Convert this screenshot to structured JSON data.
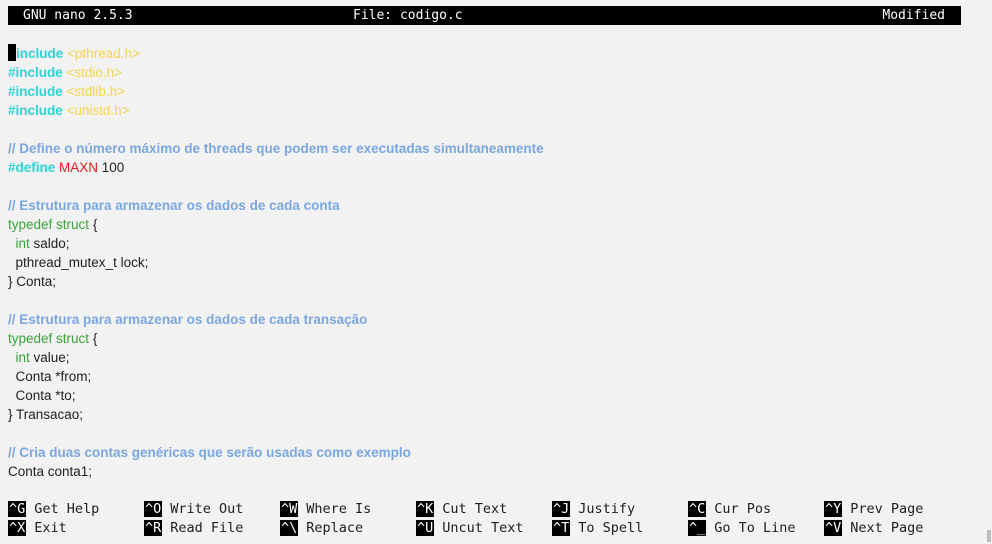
{
  "titlebar": {
    "app_version": "GNU nano 2.5.3",
    "file_label": "File: codigo.c",
    "status": "Modified"
  },
  "code": {
    "l1a": "include",
    "l1b": " <pthread.h>",
    "l2a": "#include",
    "l2b": " <stdio.h>",
    "l3a": "#include",
    "l3b": " <stdlib.h>",
    "l4a": "#include",
    "l4b": " <unistd.h>",
    "c1": "// Define o número máximo de threads que podem ser executadas simultaneamente",
    "d1": "#define",
    "d2": " MAXN",
    "d3": " 100",
    "c2": "// Estrutura para armazenar os dados de cada conta",
    "s1a": "typedef",
    "s1b": " struct",
    "s1c": " {",
    "s2a": "  int",
    "s2b": " saldo;",
    "s3": "  pthread_mutex_t lock;",
    "s4": "} Conta;",
    "c3": "// Estrutura para armazenar os dados de cada transação",
    "t1a": "typedef",
    "t1b": " struct",
    "t1c": " {",
    "t2a": "  int",
    "t2b": " value;",
    "t3": "  Conta *from;",
    "t4": "  Conta *to;",
    "t5": "} Transacao;",
    "c4": "// Cria duas contas genéricas que serão usadas como exemplo",
    "last": "Conta conta1;"
  },
  "shortcuts": [
    {
      "key": "^G",
      "label": "Get Help"
    },
    {
      "key": "^O",
      "label": "Write Out"
    },
    {
      "key": "^W",
      "label": "Where Is"
    },
    {
      "key": "^K",
      "label": "Cut Text"
    },
    {
      "key": "^J",
      "label": "Justify"
    },
    {
      "key": "^C",
      "label": "Cur Pos"
    },
    {
      "key": "^Y",
      "label": "Prev Page"
    },
    {
      "key": "^X",
      "label": "Exit"
    },
    {
      "key": "^R",
      "label": "Read File"
    },
    {
      "key": "^\\",
      "label": "Replace"
    },
    {
      "key": "^U",
      "label": "Uncut Text"
    },
    {
      "key": "^T",
      "label": "To Spell"
    },
    {
      "key": "^_",
      "label": "Go To Line"
    },
    {
      "key": "^V",
      "label": "Next Page"
    }
  ]
}
